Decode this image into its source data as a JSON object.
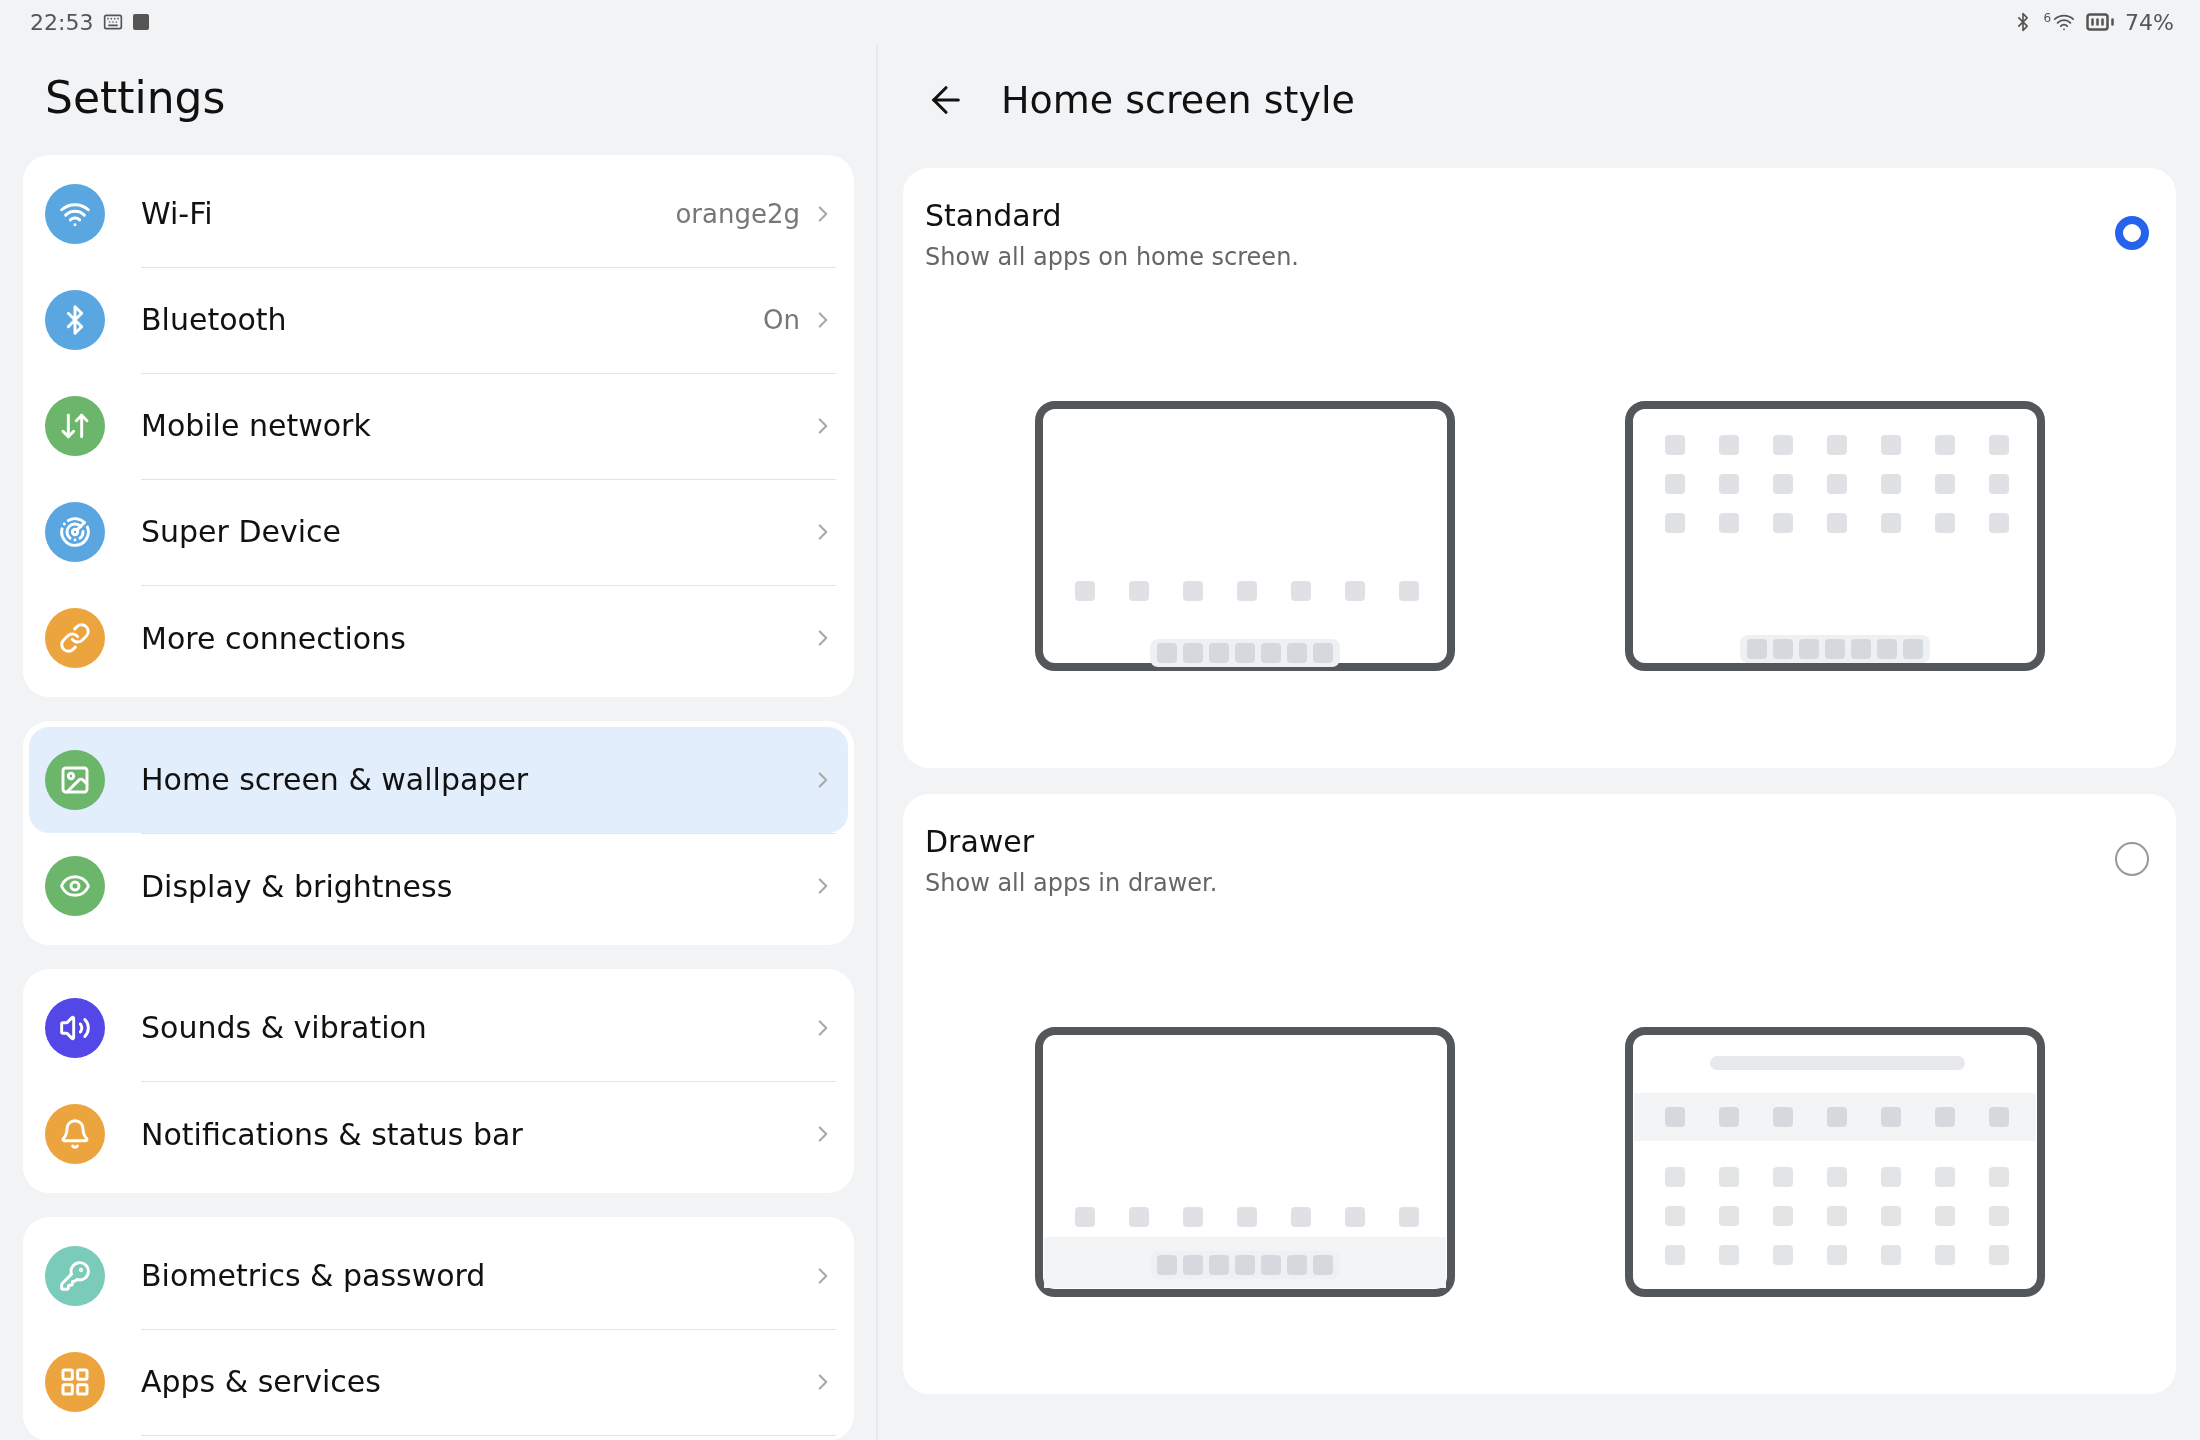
{
  "status_bar": {
    "time": "22:53",
    "wifi_badge": "6",
    "battery": "74%"
  },
  "sidebar": {
    "title": "Settings",
    "groups": [
      {
        "items": [
          {
            "color": "#5aa6e0",
            "label": "Wi-Fi",
            "value": "orange2g",
            "selected": false
          },
          {
            "color": "#5aa6e0",
            "label": "Bluetooth",
            "value": "On",
            "selected": false
          },
          {
            "color": "#6bb66a",
            "label": "Mobile network",
            "selected": false
          },
          {
            "color": "#5aa6e0",
            "label": "Super Device",
            "selected": false
          },
          {
            "color": "#eca43f",
            "label": "More connections",
            "selected": false
          }
        ]
      },
      {
        "items": [
          {
            "color": "#6bb66a",
            "label": "Home screen & wallpaper",
            "selected": true
          },
          {
            "color": "#6bb66a",
            "label": "Display & brightness",
            "selected": false
          }
        ]
      },
      {
        "items": [
          {
            "color": "#5447e8",
            "label": "Sounds & vibration",
            "selected": false
          },
          {
            "color": "#eca43f",
            "label": "Notifications & status bar",
            "selected": false
          }
        ]
      },
      {
        "items": [
          {
            "color": "#7acbb9",
            "label": "Biometrics & password",
            "selected": false
          },
          {
            "color": "#eca43f",
            "label": "Apps & services",
            "selected": false
          }
        ]
      }
    ]
  },
  "detail": {
    "title": "Home screen style",
    "options": [
      {
        "title": "Standard",
        "description": "Show all apps on home screen.",
        "selected": true,
        "previews": [
          {
            "kind": "home-dock"
          },
          {
            "kind": "grid-dock"
          }
        ]
      },
      {
        "title": "Drawer",
        "description": "Show all apps in drawer.",
        "selected": false,
        "previews": [
          {
            "kind": "home-tray"
          },
          {
            "kind": "drawer-open"
          }
        ]
      }
    ]
  }
}
